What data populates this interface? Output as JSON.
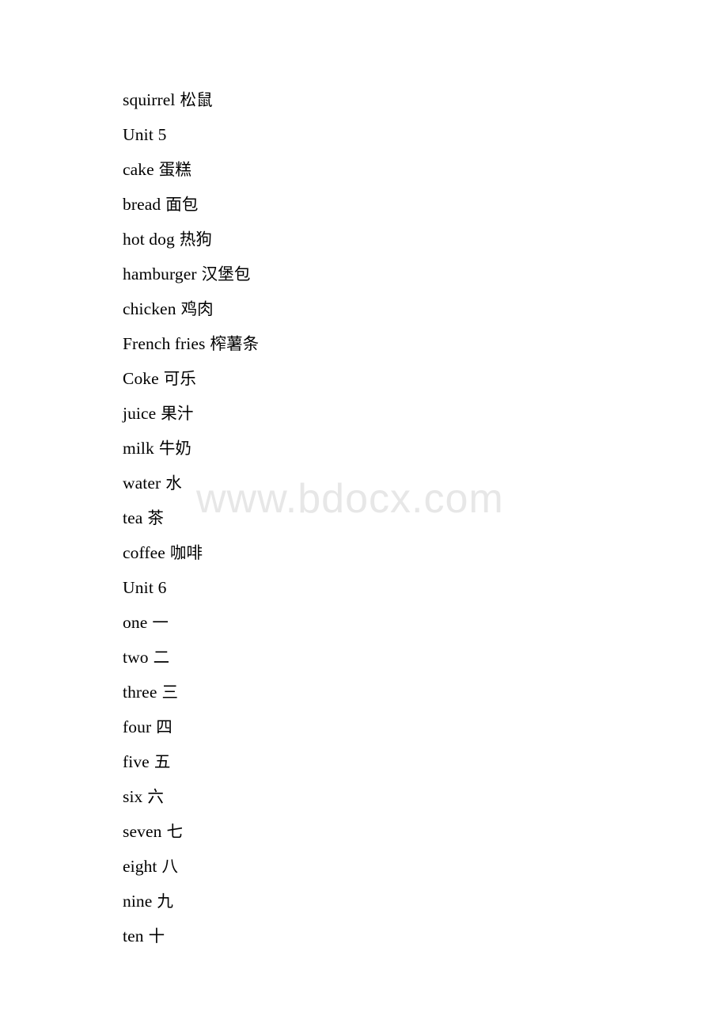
{
  "document": {
    "watermark": "www.bdocx.com",
    "watermark_color": "#e7e7e7",
    "text_color": "#000000",
    "background_color": "#ffffff"
  },
  "lines": [
    {
      "en": "squirrel",
      "zh": "松鼠",
      "type": "entry"
    },
    {
      "en": "Unit 5",
      "zh": "",
      "type": "heading"
    },
    {
      "en": "cake",
      "zh": "蛋糕",
      "type": "entry"
    },
    {
      "en": "bread",
      "zh": "面包",
      "type": "entry"
    },
    {
      "en": "hot dog",
      "zh": "热狗",
      "type": "entry"
    },
    {
      "en": "hamburger",
      "zh": "汉堡包",
      "type": "entry"
    },
    {
      "en": "chicken",
      "zh": "鸡肉",
      "type": "entry"
    },
    {
      "en": "French fries",
      "zh": "榨薯条",
      "type": "entry"
    },
    {
      "en": "Coke",
      "zh": "可乐",
      "type": "entry"
    },
    {
      "en": "juice",
      "zh": "果汁",
      "type": "entry"
    },
    {
      "en": "milk",
      "zh": "牛奶",
      "type": "entry"
    },
    {
      "en": "water",
      "zh": "水",
      "type": "entry"
    },
    {
      "en": "tea",
      "zh": "茶",
      "type": "entry"
    },
    {
      "en": "coffee",
      "zh": "咖啡",
      "type": "entry"
    },
    {
      "en": "Unit 6",
      "zh": "",
      "type": "heading"
    },
    {
      "en": "one",
      "zh": "一",
      "type": "entry"
    },
    {
      "en": "two",
      "zh": "二",
      "type": "entry"
    },
    {
      "en": "three",
      "zh": "三",
      "type": "entry"
    },
    {
      "en": "four",
      "zh": "四",
      "type": "entry"
    },
    {
      "en": "five",
      "zh": "五",
      "type": "entry"
    },
    {
      "en": "six",
      "zh": "六",
      "type": "entry"
    },
    {
      "en": "seven",
      "zh": "七",
      "type": "entry"
    },
    {
      "en": "eight",
      "zh": "八",
      "type": "entry"
    },
    {
      "en": "nine",
      "zh": "九",
      "type": "entry"
    },
    {
      "en": "ten",
      "zh": "十",
      "type": "entry"
    }
  ]
}
